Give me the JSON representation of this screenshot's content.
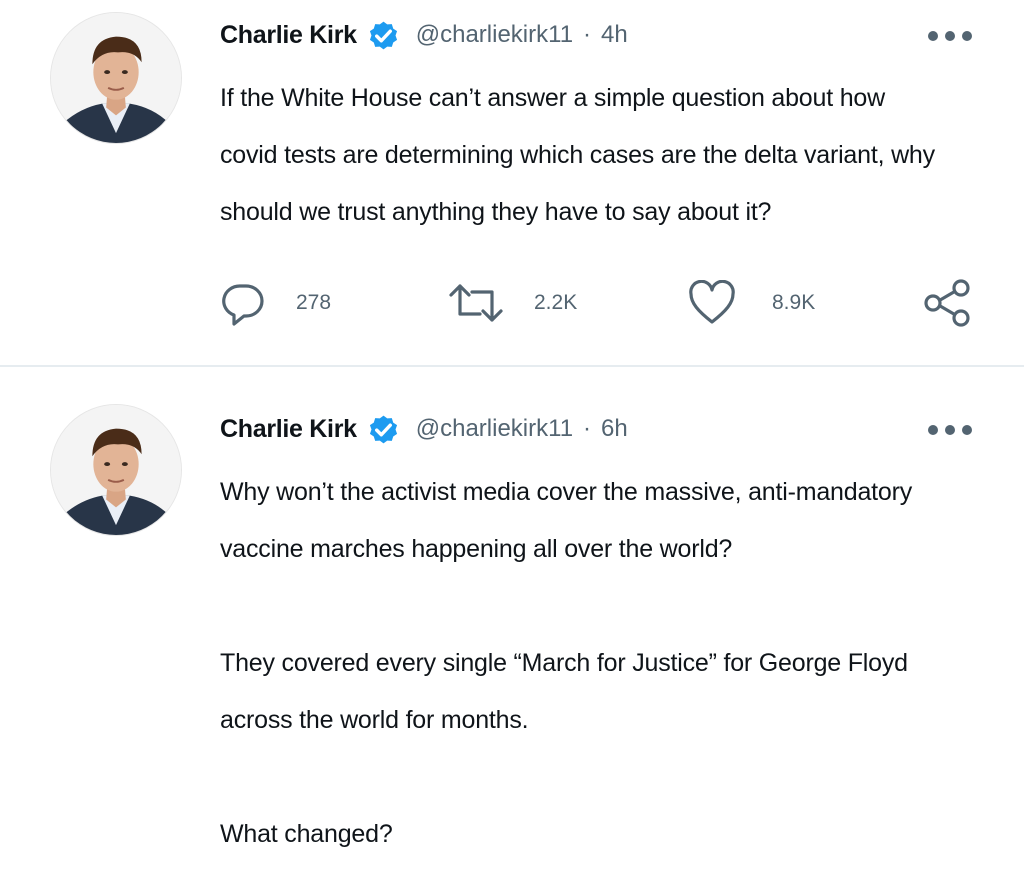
{
  "tweets": [
    {
      "author": "Charlie Kirk",
      "handle": "@charliekirk11",
      "separator": "·",
      "time": "4h",
      "lines": [
        "If the White House can’t answer a simple question about how",
        "covid tests are determining which cases are the delta variant, why",
        "should we trust anything they have to say about it?"
      ],
      "reply_count": "278",
      "retweet_count": "2.2K",
      "like_count": "8.9K"
    },
    {
      "author": "Charlie Kirk",
      "handle": "@charliekirk11",
      "separator": "·",
      "time": "6h",
      "lines": [
        "Why won’t the activist media cover the massive, anti-mandatory",
        "vaccine marches happening all over the world?",
        "",
        "They covered every single “March for Justice” for George Floyd",
        "across the world for months.",
        "",
        "What changed?"
      ]
    }
  ],
  "colors": {
    "verified": "#1d9bf0",
    "muted": "#536471",
    "text": "#0f1419",
    "divider": "#e6ecf0"
  },
  "icons": {
    "verified": "verified-badge-icon",
    "more": "more-options-icon",
    "reply": "reply-icon",
    "retweet": "retweet-icon",
    "like": "like-icon",
    "share": "share-icon"
  }
}
